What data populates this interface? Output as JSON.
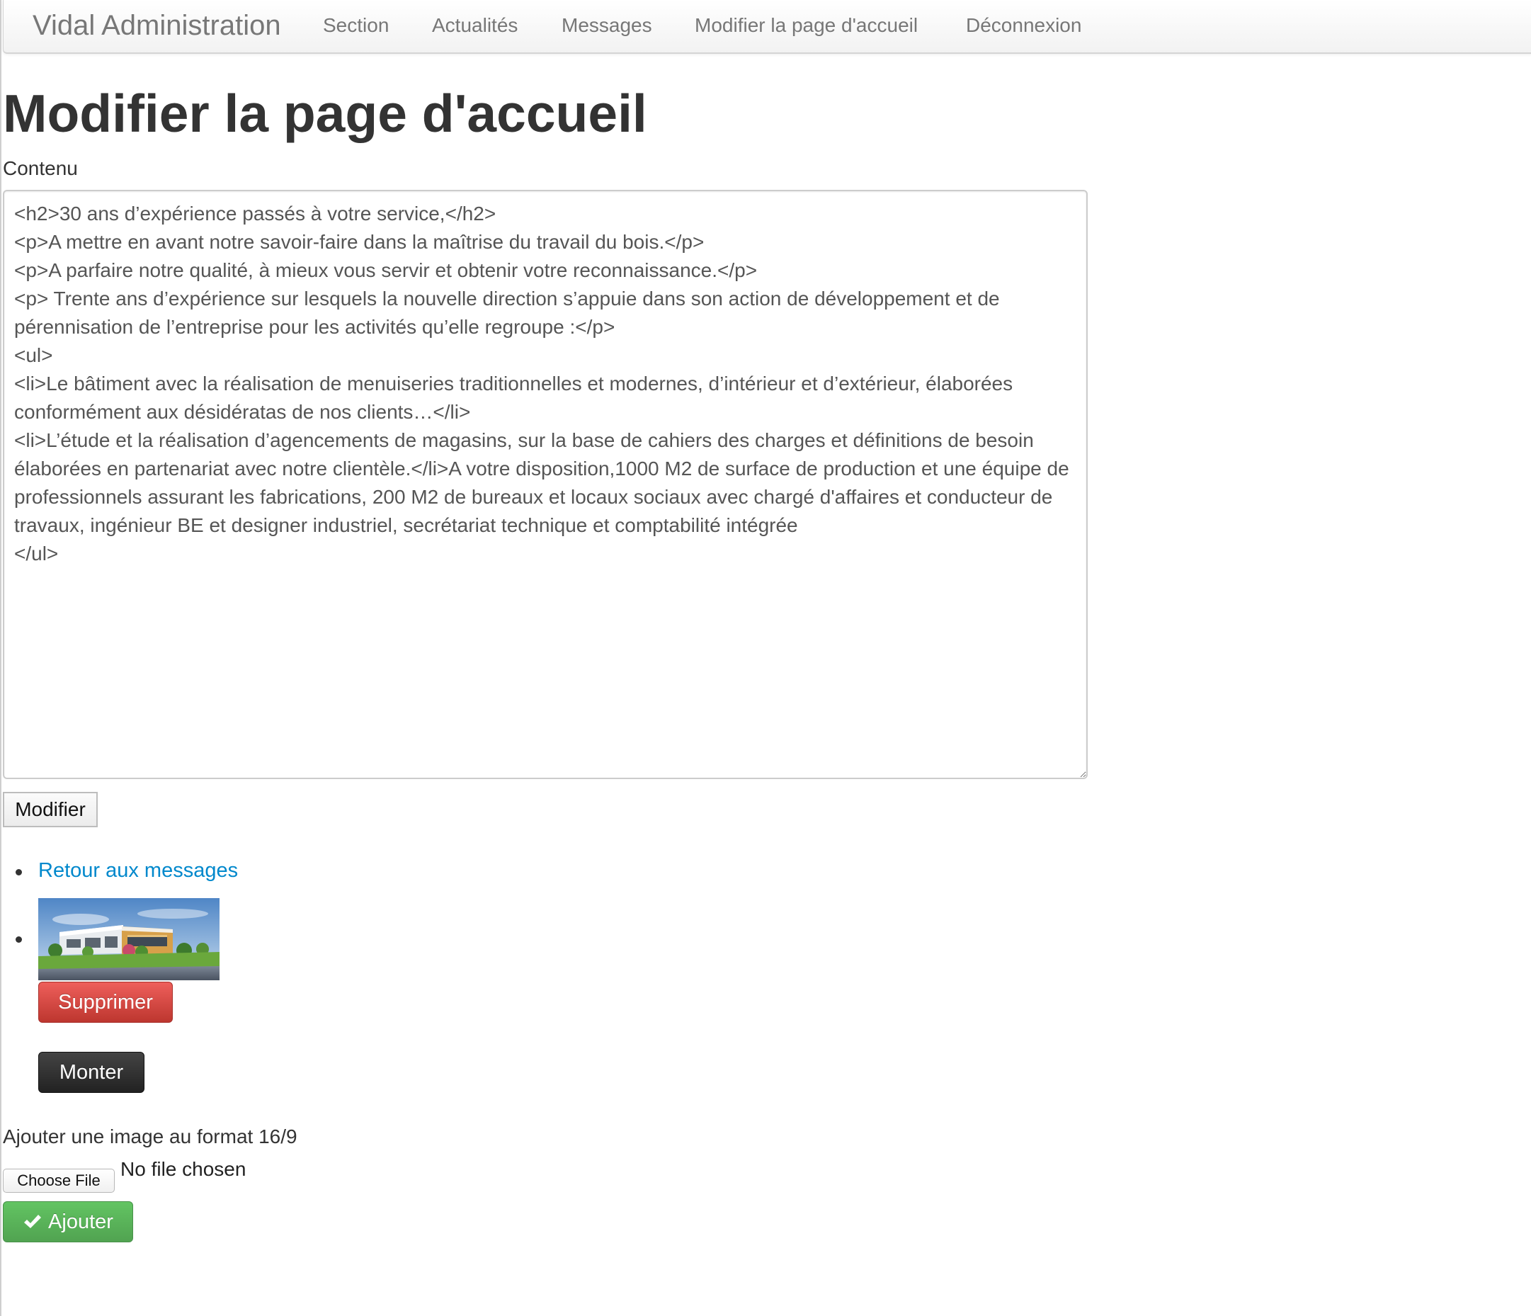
{
  "navbar": {
    "brand": "Vidal Administration",
    "items": [
      {
        "label": "Section"
      },
      {
        "label": "Actualités"
      },
      {
        "label": "Messages"
      },
      {
        "label": "Modifier la page d'accueil"
      },
      {
        "label": "Déconnexion"
      }
    ]
  },
  "page": {
    "title": "Modifier la page d'accueil"
  },
  "form": {
    "content_label": "Contenu",
    "content_value": "<h2>30 ans d’expérience passés à votre service,</h2>\n<p>A mettre en avant notre savoir-faire dans la maîtrise du travail du bois.</p>\n<p>A parfaire notre qualité, à mieux vous servir et obtenir votre reconnaissance.</p>\n<p> Trente ans d’expérience sur lesquels la nouvelle direction s’appuie dans son action de développement et de pérennisation de l’entreprise pour les activités qu’elle regroupe :</p>\n<ul>\n<li>Le bâtiment avec la réalisation de menuiseries traditionnelles et modernes, d’intérieur et d’extérieur, élaborées conformément aux désidératas de nos clients…</li>\n<li>L’étude et la réalisation d’agencements de magasins, sur la base de cahiers des charges et définitions de besoin élaborées en partenariat avec notre clientèle.</li>A votre disposition,1000 M2 de surface de production et une équipe de professionnels assurant les fabrications, 200 M2 de bureaux et locaux sociaux avec chargé d'affaires et conducteur de travaux, ingénieur BE et designer industriel, secrétariat technique et comptabilité intégrée\n</ul>",
    "submit_label": "Modifier"
  },
  "links": {
    "back_label": "Retour aux messages"
  },
  "image_item": {
    "delete_label": "Supprimer",
    "up_label": "Monter"
  },
  "upload": {
    "label": "Ajouter une image au format 16/9",
    "file_button_label": "Choose File",
    "file_status": "No file chosen",
    "add_label": "Ajouter"
  },
  "colors": {
    "link": "#0088cc",
    "danger": "#da4f49",
    "inverse": "#333333",
    "success": "#5bb75b"
  },
  "icons": {
    "add_icon": "check-icon"
  }
}
